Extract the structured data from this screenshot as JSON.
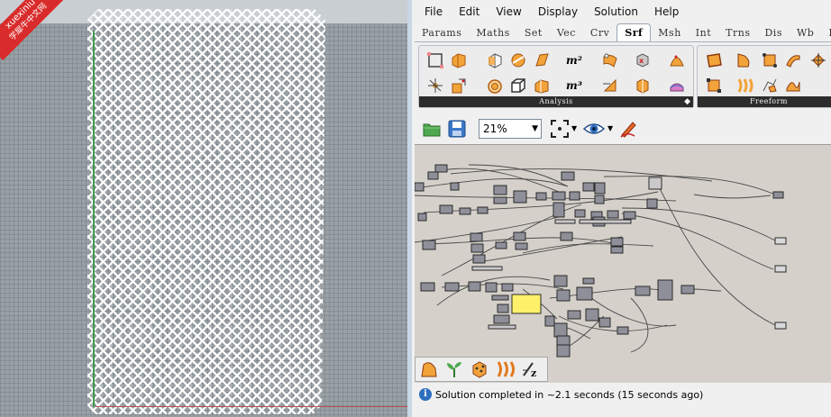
{
  "watermark": {
    "line1": "xuexiniu",
    "line2": "学犀牛中文网"
  },
  "menu": [
    "File",
    "Edit",
    "View",
    "Display",
    "Solution",
    "Help"
  ],
  "tabs": [
    {
      "label": "Params",
      "active": false
    },
    {
      "label": "Maths",
      "active": false
    },
    {
      "label": "Set",
      "active": false
    },
    {
      "label": "Vec",
      "active": false
    },
    {
      "label": "Crv",
      "active": false
    },
    {
      "label": "Srf",
      "active": true
    },
    {
      "label": "Msh",
      "active": false
    },
    {
      "label": "Int",
      "active": false
    },
    {
      "label": "Trns",
      "active": false
    },
    {
      "label": "Dis",
      "active": false
    },
    {
      "label": "Wb",
      "active": false
    },
    {
      "label": "Panelin",
      "active": false
    }
  ],
  "panels": {
    "analysis": "Analysis",
    "freeform": "Freeform",
    "more": "◆"
  },
  "ribbon_text": {
    "m2": "m²",
    "m3": "m³"
  },
  "zoom": {
    "value": "21%"
  },
  "status": {
    "message": "Solution completed in ~2.1 seconds (15 seconds ago)"
  },
  "colors": {
    "accent_yellow": "#fff16a",
    "node_gray": "#8f8f9a",
    "canvas_bg": "#d5d1ca",
    "axis_green": "#3e9c4e",
    "axis_red": "#b45050"
  },
  "icons": {
    "open": "open-file-icon",
    "save": "save-icon",
    "zoom_extents": "zoom-extents-icon",
    "preview": "preview-eye-icon",
    "sketch": "sketch-pen-icon"
  }
}
